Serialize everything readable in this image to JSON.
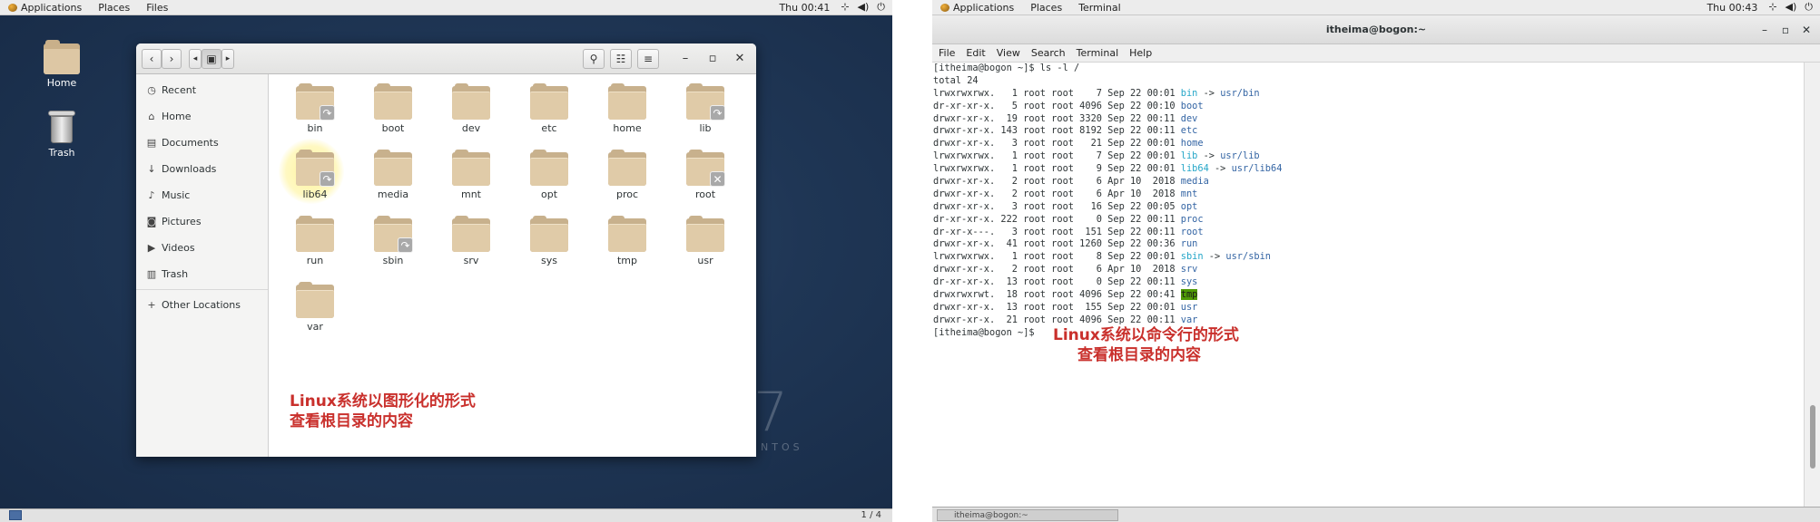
{
  "left_panel": {
    "topbar": {
      "applications": "Applications",
      "places": "Places",
      "files": "Files",
      "clock": "Thu 00:41",
      "network_icon": "network-icon",
      "volume_icon": "volume-icon",
      "power_icon": "power-icon"
    },
    "desktop": {
      "home_label": "Home",
      "trash_label": "Trash",
      "watermark_number": "7",
      "watermark_text": "NTOS"
    },
    "file_manager": {
      "sidebar": [
        {
          "icon": "clock-icon",
          "glyph": "◷",
          "label": "Recent"
        },
        {
          "icon": "home-icon",
          "glyph": "⌂",
          "label": "Home"
        },
        {
          "icon": "document-icon",
          "glyph": "▤",
          "label": "Documents"
        },
        {
          "icon": "download-icon",
          "glyph": "↓",
          "label": "Downloads"
        },
        {
          "icon": "music-icon",
          "glyph": "♪",
          "label": "Music"
        },
        {
          "icon": "camera-icon",
          "glyph": "◙",
          "label": "Pictures"
        },
        {
          "icon": "video-icon",
          "glyph": "▶",
          "label": "Videos"
        },
        {
          "icon": "trash-icon",
          "glyph": "▥",
          "label": "Trash"
        },
        {
          "icon": "plus-icon",
          "glyph": "+",
          "label": "Other Locations"
        }
      ],
      "files": [
        {
          "name": "bin",
          "emblem": "link"
        },
        {
          "name": "boot",
          "emblem": ""
        },
        {
          "name": "dev",
          "emblem": ""
        },
        {
          "name": "etc",
          "emblem": ""
        },
        {
          "name": "home",
          "emblem": ""
        },
        {
          "name": "lib",
          "emblem": "link"
        },
        {
          "name": "lib64",
          "emblem": "link"
        },
        {
          "name": "media",
          "emblem": ""
        },
        {
          "name": "mnt",
          "emblem": ""
        },
        {
          "name": "opt",
          "emblem": ""
        },
        {
          "name": "proc",
          "emblem": ""
        },
        {
          "name": "root",
          "emblem": "locked"
        },
        {
          "name": "run",
          "emblem": ""
        },
        {
          "name": "sbin",
          "emblem": "link"
        },
        {
          "name": "srv",
          "emblem": ""
        },
        {
          "name": "sys",
          "emblem": ""
        },
        {
          "name": "tmp",
          "emblem": ""
        },
        {
          "name": "usr",
          "emblem": ""
        },
        {
          "name": "var",
          "emblem": ""
        }
      ],
      "note_line1": "Linux系统以图形化的形式",
      "note_line2": "查看根目录的内容"
    },
    "bottom_bar": {
      "page_indicator": "1 / 4"
    }
  },
  "right_panel": {
    "topbar": {
      "applications": "Applications",
      "places": "Places",
      "terminal": "Terminal",
      "clock": "Thu 00:43"
    },
    "terminal": {
      "title": "itheima@bogon:~",
      "menu": [
        "File",
        "Edit",
        "View",
        "Search",
        "Terminal",
        "Help"
      ],
      "prompt_cmd": "[itheima@bogon ~]$ ls -l /",
      "total": "total 24",
      "entries": [
        {
          "prefix": "lrwxrwxrwx.   1 root root    7 Sep 22 00:01 ",
          "name": "bin",
          "target": "usr/bin",
          "style": "link"
        },
        {
          "prefix": "dr-xr-xr-x.   5 root root 4096 Sep 22 00:10 ",
          "name": "boot",
          "target": "",
          "style": "dir"
        },
        {
          "prefix": "drwxr-xr-x.  19 root root 3320 Sep 22 00:11 ",
          "name": "dev",
          "target": "",
          "style": "dir"
        },
        {
          "prefix": "drwxr-xr-x. 143 root root 8192 Sep 22 00:11 ",
          "name": "etc",
          "target": "",
          "style": "dir"
        },
        {
          "prefix": "drwxr-xr-x.   3 root root   21 Sep 22 00:01 ",
          "name": "home",
          "target": "",
          "style": "dir"
        },
        {
          "prefix": "lrwxrwxrwx.   1 root root    7 Sep 22 00:01 ",
          "name": "lib",
          "target": "usr/lib",
          "style": "link"
        },
        {
          "prefix": "lrwxrwxrwx.   1 root root    9 Sep 22 00:01 ",
          "name": "lib64",
          "target": "usr/lib64",
          "style": "link"
        },
        {
          "prefix": "drwxr-xr-x.   2 root root    6 Apr 10  2018 ",
          "name": "media",
          "target": "",
          "style": "dir"
        },
        {
          "prefix": "drwxr-xr-x.   2 root root    6 Apr 10  2018 ",
          "name": "mnt",
          "target": "",
          "style": "dir"
        },
        {
          "prefix": "drwxr-xr-x.   3 root root   16 Sep 22 00:05 ",
          "name": "opt",
          "target": "",
          "style": "dir"
        },
        {
          "prefix": "dr-xr-xr-x. 222 root root    0 Sep 22 00:11 ",
          "name": "proc",
          "target": "",
          "style": "dir"
        },
        {
          "prefix": "dr-xr-x---.   3 root root  151 Sep 22 00:11 ",
          "name": "root",
          "target": "",
          "style": "dir"
        },
        {
          "prefix": "drwxr-xr-x.  41 root root 1260 Sep 22 00:36 ",
          "name": "run",
          "target": "",
          "style": "dir"
        },
        {
          "prefix": "lrwxrwxrwx.   1 root root    8 Sep 22 00:01 ",
          "name": "sbin",
          "target": "usr/sbin",
          "style": "link"
        },
        {
          "prefix": "drwxr-xr-x.   2 root root    6 Apr 10  2018 ",
          "name": "srv",
          "target": "",
          "style": "dir"
        },
        {
          "prefix": "dr-xr-xr-x.  13 root root    0 Sep 22 00:11 ",
          "name": "sys",
          "target": "",
          "style": "dir"
        },
        {
          "prefix": "drwxrwxrwt.  18 root root 4096 Sep 22 00:41 ",
          "name": "tmp",
          "target": "",
          "style": "sticky"
        },
        {
          "prefix": "drwxr-xr-x.  13 root root  155 Sep 22 00:01 ",
          "name": "usr",
          "target": "",
          "style": "dir"
        },
        {
          "prefix": "drwxr-xr-x.  21 root root 4096 Sep 22 00:11 ",
          "name": "var",
          "target": "",
          "style": "dir"
        }
      ],
      "prompt_end": "[itheima@bogon ~]$ ",
      "note_line1": "Linux系统以命令行的形式",
      "note_line2": "查看根目录的内容"
    },
    "taskbar": {
      "window_label": "itheima@bogon:~"
    }
  },
  "colors": {
    "note_red": "#c9302c",
    "link_cyan": "#25a6c8",
    "dir_blue": "#3465a4",
    "sticky_bg": "#4e9a06"
  }
}
